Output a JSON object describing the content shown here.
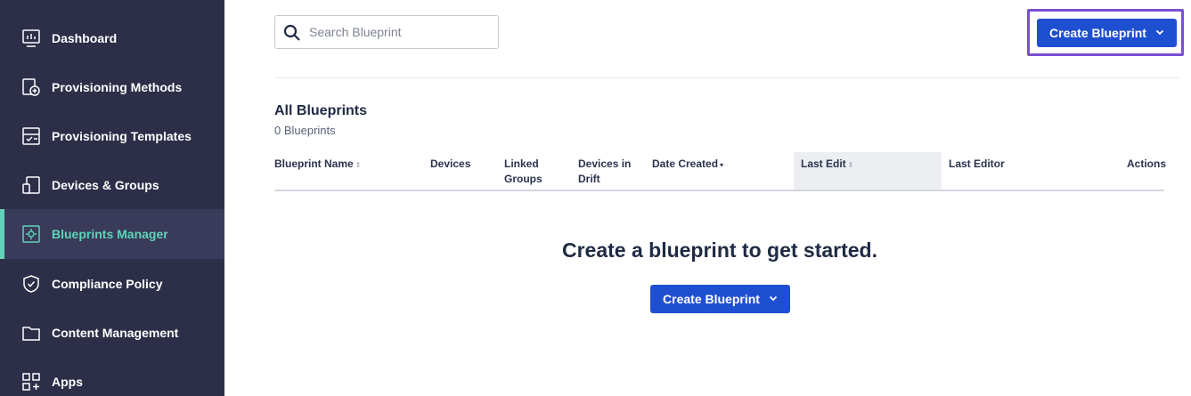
{
  "sidebar": {
    "items": [
      {
        "label": "Dashboard",
        "icon": "dashboard-icon"
      },
      {
        "label": "Provisioning Methods",
        "icon": "provisioning-methods-icon"
      },
      {
        "label": "Provisioning Templates",
        "icon": "provisioning-templates-icon"
      },
      {
        "label": "Devices & Groups",
        "icon": "devices-icon"
      },
      {
        "label": "Blueprints Manager",
        "icon": "blueprints-icon",
        "active": true
      },
      {
        "label": "Compliance Policy",
        "icon": "shield-icon"
      },
      {
        "label": "Content Management",
        "icon": "folder-icon"
      },
      {
        "label": "Apps",
        "icon": "apps-grid-icon"
      }
    ],
    "active_color": "#5fd3b8"
  },
  "search": {
    "placeholder": "Search Blueprint",
    "icon": "search-icon"
  },
  "header": {
    "create_button_label": "Create Blueprint",
    "create_button_icon": "chevron-down-icon"
  },
  "section": {
    "title": "All Blueprints",
    "count": "0 Blueprints"
  },
  "table": {
    "columns": [
      {
        "label": "Blueprint Name",
        "sortable": true
      },
      {
        "label": "Devices"
      },
      {
        "label": "Linked Groups"
      },
      {
        "label": "Devices in Drift"
      },
      {
        "label": "Date Created",
        "sort": "desc"
      },
      {
        "label": "Last Edit",
        "sortable": true
      },
      {
        "label": "Last Editor"
      },
      {
        "label": "Actions"
      }
    ]
  },
  "empty_state": {
    "message": "Create a blueprint to get started.",
    "button_label": "Create Blueprint"
  },
  "colors": {
    "primary": "#1f4fd1",
    "sidebar_bg": "#2d2e48",
    "highlight": "#7a4fd3"
  }
}
